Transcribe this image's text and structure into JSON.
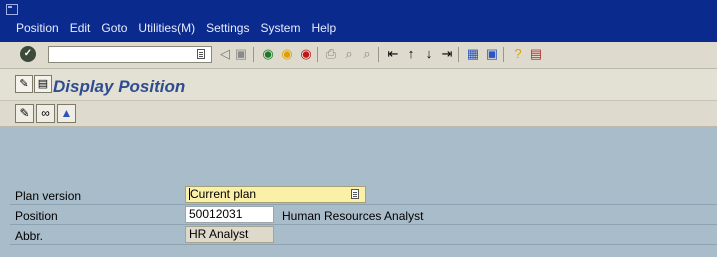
{
  "menu": {
    "items": [
      "Position",
      "Edit",
      "Goto",
      "Utilities(M)",
      "Settings",
      "System",
      "Help"
    ]
  },
  "toolbar": {
    "command_value": "",
    "icons": [
      "enter-icon",
      "back-icon",
      "exit-icon",
      "cancel-icon",
      "print-icon",
      "find-icon",
      "find-next-icon",
      "first-page-icon",
      "previous-page-icon",
      "next-page-icon",
      "last-page-icon",
      "new-session-icon",
      "shortcut-icon",
      "help-icon",
      "layout-icon"
    ]
  },
  "title": {
    "text": "Display Position"
  },
  "form": {
    "plan_version_label": "Plan version",
    "plan_version_value": "Current plan",
    "position_label": "Position",
    "position_value": "50012031",
    "position_description": "Human Resources Analyst",
    "abbr_label": "Abbr.",
    "abbr_value": "HR Analyst"
  },
  "colors": {
    "menubar": "#0b2a8e",
    "title_text": "#2f4c8f",
    "content_bg": "#a9bcc9",
    "required_field": "#fbf0a8"
  }
}
